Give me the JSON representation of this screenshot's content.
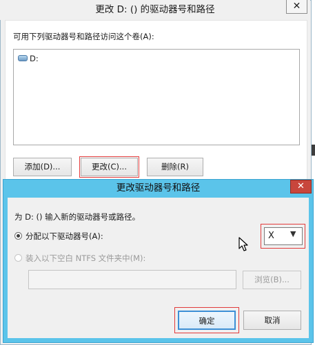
{
  "outer_dialog": {
    "title": "更改 D: () 的驱动器号和路径",
    "close_glyph": "✕",
    "instruction": "可用下列驱动器号和路径访问这个卷(A):",
    "volumes": [
      {
        "label": "D:",
        "icon": "drive-icon"
      }
    ],
    "buttons": {
      "add": "添加(D)...",
      "change": "更改(C)...",
      "delete": "删除(R)"
    }
  },
  "inner_dialog": {
    "title": "更改驱动器号和路径",
    "close_glyph": "✕",
    "prompt": "为 D: () 输入新的驱动器号或路径。",
    "option_assign": "分配以下驱动器号(A):",
    "option_mount": "装入以下空白 NTFS 文件夹中(M):",
    "drive_letter": {
      "selected": "X",
      "arrow_glyph": "▼"
    },
    "path_value": "",
    "browse": "浏览(B)...",
    "ok": "确定",
    "cancel": "取消"
  },
  "colors": {
    "highlight_outline": "#e23a3a",
    "inner_frame": "#5bc4ea",
    "close_red": "#c8463c",
    "default_button_border": "#3c8fd6"
  }
}
